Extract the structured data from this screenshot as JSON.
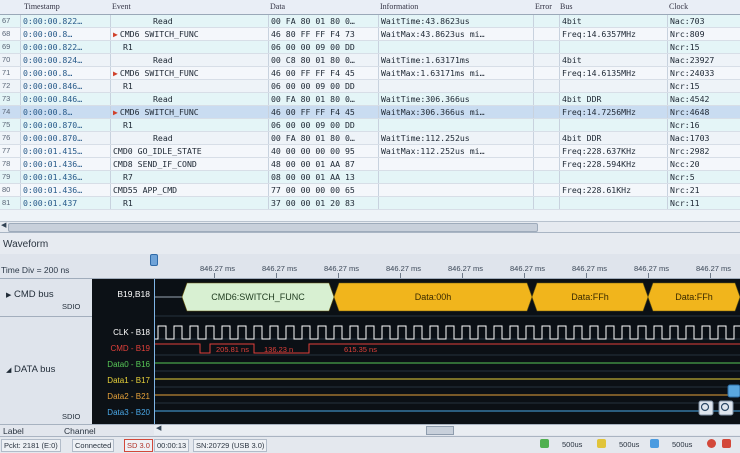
{
  "table": {
    "columns": [
      "Timestamp",
      "Event",
      "Data",
      "Information",
      "Error",
      "Bus",
      "Clock"
    ],
    "rows": [
      {
        "idx": "67",
        "ts": "0:00:00.822…",
        "event": "Read",
        "data": "00 FA 80 01 80 0…",
        "info": "WaitTime:43.8623us",
        "err": "",
        "bus": "4bit",
        "clock": "Nac:703",
        "kind": "read"
      },
      {
        "idx": "68",
        "ts": "0:00:00.8…",
        "event": "CMD6 SWITCH_FUNC",
        "data": "46 80 FF FF F4 73",
        "info": "WaitMax:43.8623us  mi…",
        "err": "",
        "bus": "Freq:14.6357MHz",
        "clock": "Nrc:809",
        "kind": "cmd",
        "arrow": true
      },
      {
        "idx": "69",
        "ts": "0:00:00.822…",
        "event": "R1",
        "data": "06 00 00 09 00 DD",
        "info": "",
        "err": "",
        "bus": "",
        "clock": "Ncr:15",
        "kind": "resp"
      },
      {
        "idx": "70",
        "ts": "0:00:00.824…",
        "event": "Read",
        "data": "00 C8 80 01 80 0…",
        "info": "WaitTime:1.63171ms",
        "err": "",
        "bus": "4bit",
        "clock": "Nac:23927",
        "kind": "read"
      },
      {
        "idx": "71",
        "ts": "0:00:00.8…",
        "event": "CMD6 SWITCH_FUNC",
        "data": "46 00 FF FF F4 45",
        "info": "WaitMax:1.63171ms  mi…",
        "err": "",
        "bus": "Freq:14.6135MHz",
        "clock": "Nrc:24033",
        "kind": "cmd",
        "arrow": true
      },
      {
        "idx": "72",
        "ts": "0:00:00.846…",
        "event": "R1",
        "data": "06 00 00 09 00 DD",
        "info": "",
        "err": "",
        "bus": "",
        "clock": "Ncr:15",
        "kind": "resp"
      },
      {
        "idx": "73",
        "ts": "0:00:00.846…",
        "event": "Read",
        "data": "00 FA 80 01 80 0…",
        "info": "WaitTime:306.366us",
        "err": "",
        "bus": "4bit DDR",
        "clock": "Nac:4542",
        "kind": "read"
      },
      {
        "idx": "74",
        "ts": "0:00:00.8…",
        "event": "CMD6 SWITCH_FUNC",
        "data": "46 00 FF FF F4 45",
        "info": "WaitMax:306.366us  mi…",
        "err": "",
        "bus": "Freq:14.7256MHz",
        "clock": "Nrc:4648",
        "kind": "sel",
        "arrow": true
      },
      {
        "idx": "75",
        "ts": "0:00:00.870…",
        "event": "R1",
        "data": "06 00 00 09 00 DD",
        "info": "",
        "err": "",
        "bus": "",
        "clock": "Ncr:16",
        "kind": "resp"
      },
      {
        "idx": "76",
        "ts": "0:00:00.870…",
        "event": "Read",
        "data": "00 FA 80 01 80 0…",
        "info": "WaitTime:112.252us",
        "err": "",
        "bus": "4bit DDR",
        "clock": "Nac:1703",
        "kind": "read"
      },
      {
        "idx": "77",
        "ts": "0:00:01.415…",
        "event": "CMD0 GO_IDLE_STATE",
        "data": "40 00 00 00 00 95",
        "info": "WaitMax:112.252us  mi…",
        "err": "",
        "bus": "Freq:228.637KHz",
        "clock": "Nrc:2982",
        "kind": "cmd"
      },
      {
        "idx": "78",
        "ts": "0:00:01.436…",
        "event": "CMD8 SEND_IF_COND",
        "data": "48 00 00 01 AA 87",
        "info": "",
        "err": "",
        "bus": "Freq:228.594KHz",
        "clock": "Ncc:20",
        "kind": "cmd"
      },
      {
        "idx": "79",
        "ts": "0:00:01.436…",
        "event": "R7",
        "data": "08 00 00 01 AA 13",
        "info": "",
        "err": "",
        "bus": "",
        "clock": "Ncr:5",
        "kind": "resp"
      },
      {
        "idx": "80",
        "ts": "0:00:01.436…",
        "event": "CMD55 APP_CMD",
        "data": "77 00 00 00 00 65",
        "info": "",
        "err": "",
        "bus": "Freq:228.61KHz",
        "clock": "Nrc:21",
        "kind": "cmd"
      },
      {
        "idx": "81",
        "ts": "0:00:01.437",
        "event": "R1",
        "data": "37 00 00 01 20 83",
        "info": "",
        "err": "",
        "bus": "",
        "clock": "Ncr:11",
        "kind": "resp"
      }
    ]
  },
  "waveform": {
    "title": "Waveform",
    "time_div": "Time Div = 200 ns",
    "ticks": [
      "846.27 ms",
      "846.27 ms",
      "846.27 ms",
      "846.27 ms",
      "846.27 ms",
      "846.27 ms",
      "846.27 ms",
      "846.27 ms",
      "846.27 ms",
      "846.2"
    ],
    "cmd_bus": {
      "label": "CMD bus",
      "sub": "SDIO",
      "pins": "B19,B18",
      "segments": [
        "CMD6:SWITCH_FUNC",
        "Data:00h",
        "Data:FFh",
        "Data:FFh"
      ]
    },
    "data_bus": {
      "label": "DATA bus",
      "sub": "SDIO"
    },
    "channels": [
      {
        "name": "CLK - B18",
        "color": "#ffffff"
      },
      {
        "name": "CMD - B19",
        "color": "#e0403a"
      },
      {
        "name": "Data0 - B16",
        "color": "#57c957"
      },
      {
        "name": "Data1 - B17",
        "color": "#e8d23a"
      },
      {
        "name": "Data2 - B21",
        "color": "#e6a23a"
      },
      {
        "name": "Data3 - B20",
        "color": "#4aa8e8"
      }
    ],
    "measures": [
      "205.81 ns",
      "136.23 n",
      "615.35 ns"
    ],
    "footer": {
      "label": "Label",
      "channel": "Channel"
    }
  },
  "status": {
    "items": [
      "Pckt: 2181 (E:0)",
      "Connected",
      "SD 3.0",
      "00:00:13",
      "SN:20729 (USB 3.0)"
    ],
    "right_values": [
      "500us",
      "500us",
      "500us"
    ],
    "accent": "#d3483a"
  }
}
